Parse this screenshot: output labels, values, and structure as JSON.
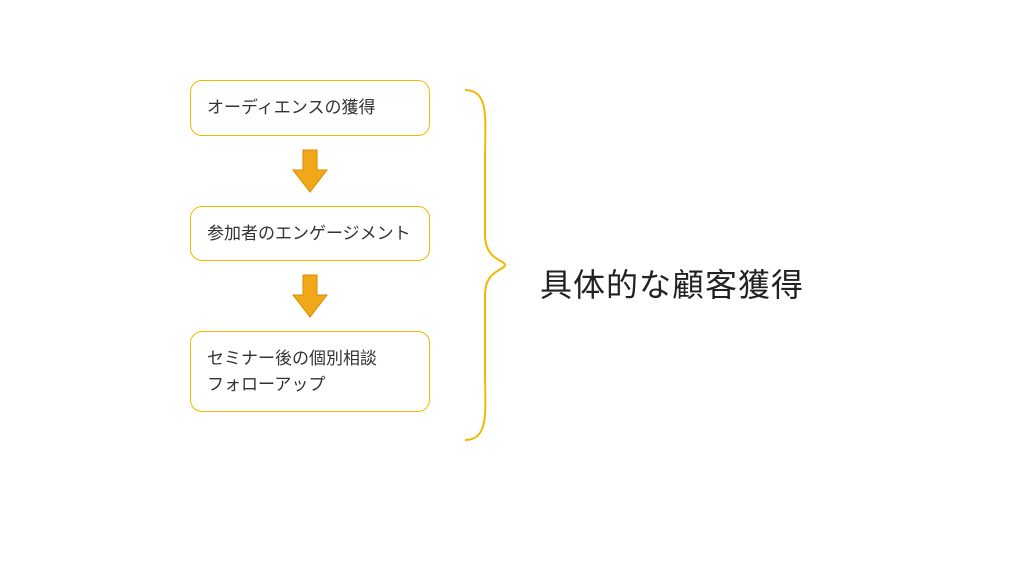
{
  "flow": {
    "step1": "オーディエンスの獲得",
    "step2": "参加者のエンゲージメント",
    "step3_line1": "セミナー後の個別相談",
    "step3_line2": "フォローアップ"
  },
  "summary": "具体的な顧客獲得",
  "colors": {
    "accent": "#f5b800",
    "arrowFill": "#f0a818",
    "bracketStroke": "#f5b800",
    "text": "#333333"
  }
}
